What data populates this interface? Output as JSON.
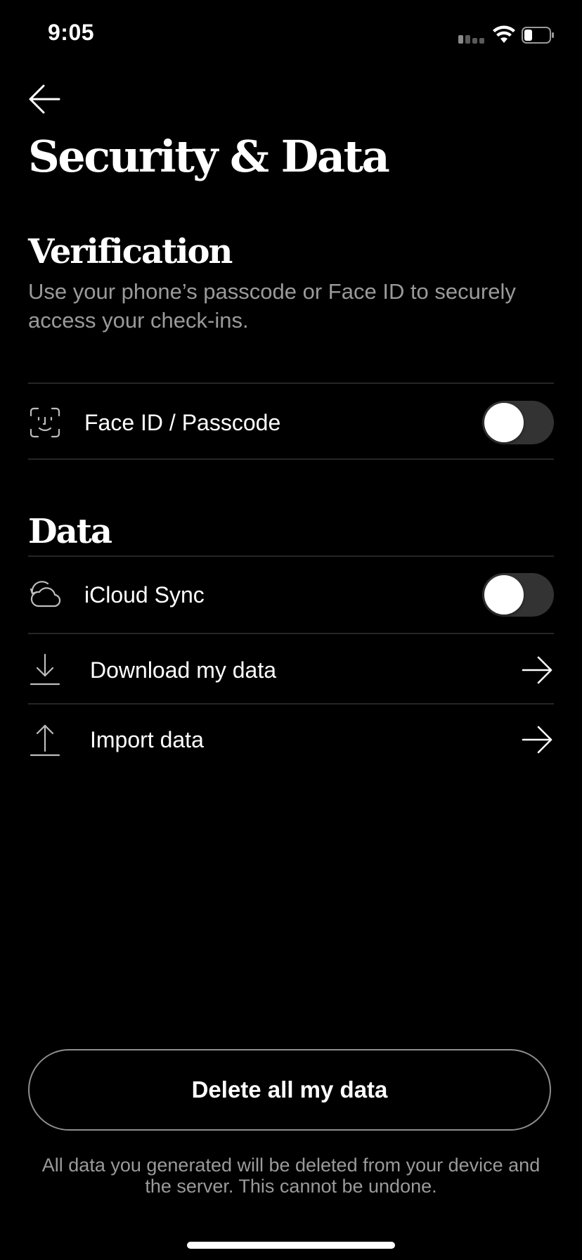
{
  "status_bar": {
    "time": "9:05"
  },
  "header": {
    "title": "Security & Data"
  },
  "verification": {
    "title": "Verification",
    "description": "Use your phone’s passcode or Face ID to securely access your check-ins.",
    "face_id": {
      "label": "Face ID / Passcode",
      "enabled": false,
      "icon": "face-id-icon"
    }
  },
  "data_section": {
    "title": "Data",
    "items": [
      {
        "label": "iCloud Sync",
        "type": "toggle",
        "enabled": false,
        "icon": "cloud-sync-icon"
      },
      {
        "label": "Download my data",
        "type": "link",
        "icon": "download-icon"
      },
      {
        "label": "Import data",
        "type": "link",
        "icon": "upload-icon"
      }
    ]
  },
  "delete": {
    "button_label": "Delete all my data",
    "note": "All data you generated will be deleted from your device and the server. This cannot be undone."
  },
  "colors": {
    "background": "#000000",
    "text": "#ffffff",
    "muted": "#9a9a9a",
    "toggle_off": "#333333"
  }
}
